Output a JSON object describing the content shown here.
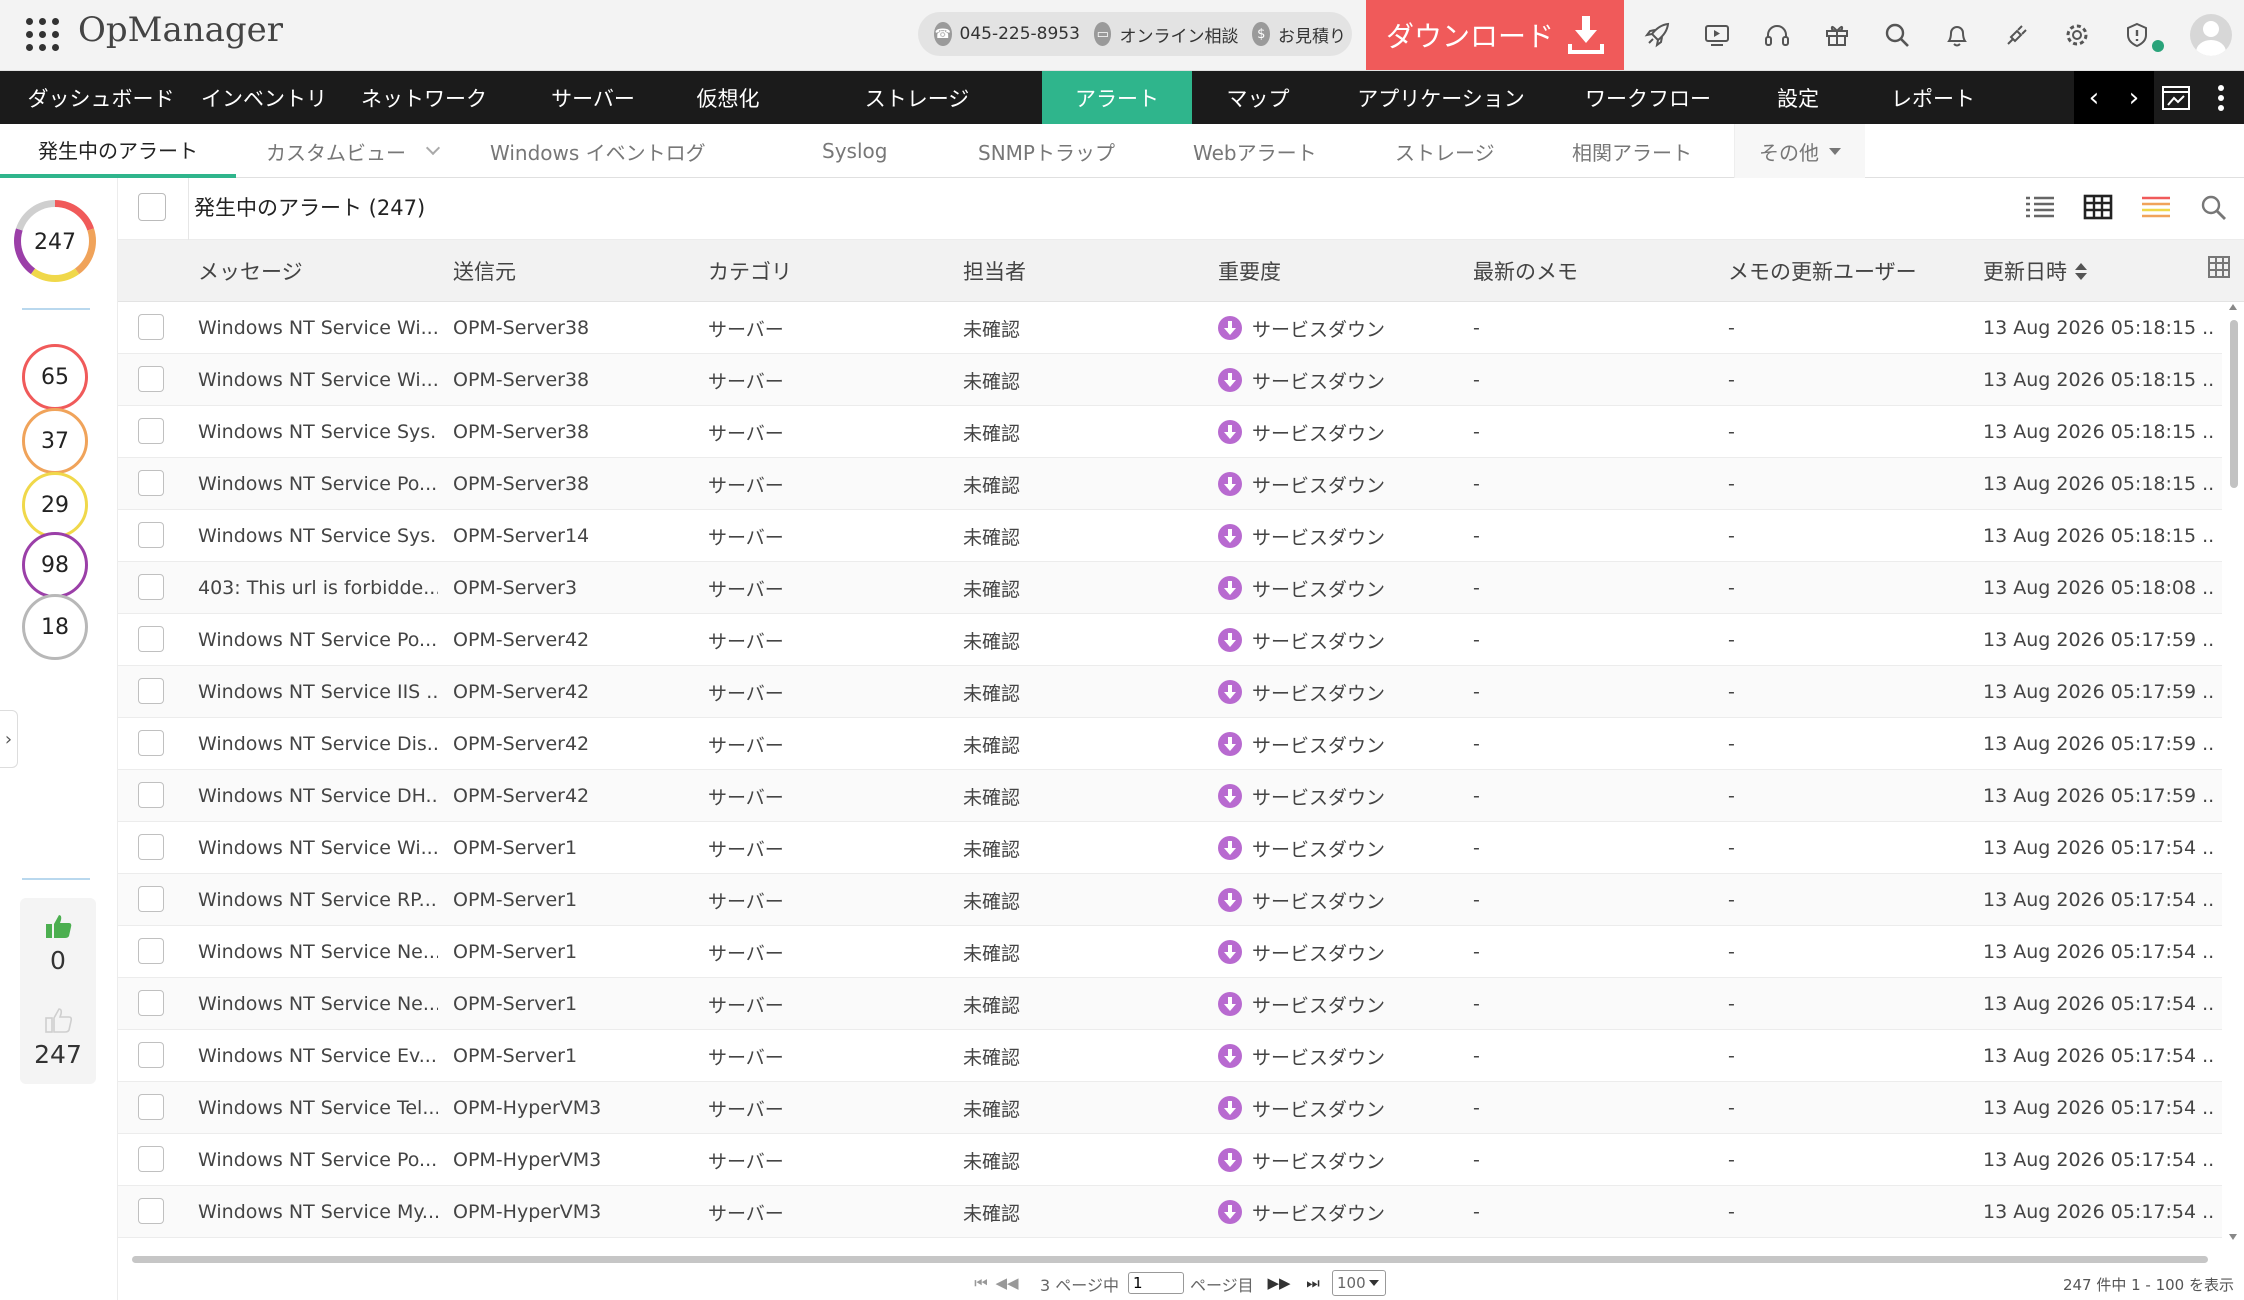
{
  "header": {
    "app_title": "OpManager",
    "phone": "045-225-8953",
    "online_consult": "オンライン相談",
    "quote": "お見積り",
    "download_label": "ダウンロード"
  },
  "nav": {
    "items": [
      {
        "label": "ダッシュボード"
      },
      {
        "label": "インベントリ"
      },
      {
        "label": "ネットワーク"
      },
      {
        "label": "サーバー"
      },
      {
        "label": "仮想化"
      },
      {
        "label": "ストレージ"
      },
      {
        "label": "アラート",
        "active": true
      },
      {
        "label": "マップ"
      },
      {
        "label": "アプリケーション"
      },
      {
        "label": "ワークフロー"
      },
      {
        "label": "設定"
      },
      {
        "label": "レポート"
      }
    ]
  },
  "subtabs": [
    {
      "label": "発生中のアラート",
      "active": true
    },
    {
      "label": "カスタムビュー"
    },
    {
      "label": "Windows イベントログ"
    },
    {
      "label": "Syslog"
    },
    {
      "label": "SNMPトラップ"
    },
    {
      "label": "Webアラート"
    },
    {
      "label": "ストレージ"
    },
    {
      "label": "相関アラート"
    },
    {
      "label": "その他"
    }
  ],
  "left_panel": {
    "total": "247",
    "severity_counts": [
      {
        "value": "65",
        "color": "#f05a5a"
      },
      {
        "value": "37",
        "color": "#f0a35a"
      },
      {
        "value": "29",
        "color": "#f0d84a"
      },
      {
        "value": "98",
        "color": "#9b3fa8"
      },
      {
        "value": "18",
        "color": "#b8b8b8"
      }
    ],
    "acknowledged": "0",
    "unacknowledged": "247",
    "donut_colors": [
      "#f05a5a",
      "#f0a35a",
      "#f0d84a",
      "#9b3fa8",
      "#cfcfcf"
    ]
  },
  "list": {
    "title": "発生中のアラート (247)"
  },
  "columns": {
    "message": "メッセージ",
    "source": "送信元",
    "category": "カテゴリ",
    "assignee": "担当者",
    "severity": "重要度",
    "last_note": "最新のメモ",
    "note_user": "メモの更新ユーザー",
    "modified": "更新日時"
  },
  "rows": [
    {
      "message": "Windows NT Service Wi...",
      "source": "OPM-Server38",
      "category": "サーバー",
      "assignee": "未確認",
      "severity": "サービスダウン",
      "note": "-",
      "note_user": "-",
      "modified": "13 Aug 2026 05:18:15 ..."
    },
    {
      "message": "Windows NT Service Wi...",
      "source": "OPM-Server38",
      "category": "サーバー",
      "assignee": "未確認",
      "severity": "サービスダウン",
      "note": "-",
      "note_user": "-",
      "modified": "13 Aug 2026 05:18:15 ..."
    },
    {
      "message": "Windows NT Service Sys...",
      "source": "OPM-Server38",
      "category": "サーバー",
      "assignee": "未確認",
      "severity": "サービスダウン",
      "note": "-",
      "note_user": "-",
      "modified": "13 Aug 2026 05:18:15 ..."
    },
    {
      "message": "Windows NT Service Po...",
      "source": "OPM-Server38",
      "category": "サーバー",
      "assignee": "未確認",
      "severity": "サービスダウン",
      "note": "-",
      "note_user": "-",
      "modified": "13 Aug 2026 05:18:15 ..."
    },
    {
      "message": "Windows NT Service Sys...",
      "source": "OPM-Server14",
      "category": "サーバー",
      "assignee": "未確認",
      "severity": "サービスダウン",
      "note": "-",
      "note_user": "-",
      "modified": "13 Aug 2026 05:18:15 ..."
    },
    {
      "message": "403: This url is forbidde...",
      "source": "OPM-Server3",
      "category": "サーバー",
      "assignee": "未確認",
      "severity": "サービスダウン",
      "note": "-",
      "note_user": "-",
      "modified": "13 Aug 2026 05:18:08 ..."
    },
    {
      "message": "Windows NT Service Po...",
      "source": "OPM-Server42",
      "category": "サーバー",
      "assignee": "未確認",
      "severity": "サービスダウン",
      "note": "-",
      "note_user": "-",
      "modified": "13 Aug 2026 05:17:59 ..."
    },
    {
      "message": "Windows NT Service IIS ...",
      "source": "OPM-Server42",
      "category": "サーバー",
      "assignee": "未確認",
      "severity": "サービスダウン",
      "note": "-",
      "note_user": "-",
      "modified": "13 Aug 2026 05:17:59 ..."
    },
    {
      "message": "Windows NT Service Dis...",
      "source": "OPM-Server42",
      "category": "サーバー",
      "assignee": "未確認",
      "severity": "サービスダウン",
      "note": "-",
      "note_user": "-",
      "modified": "13 Aug 2026 05:17:59 ..."
    },
    {
      "message": "Windows NT Service DH...",
      "source": "OPM-Server42",
      "category": "サーバー",
      "assignee": "未確認",
      "severity": "サービスダウン",
      "note": "-",
      "note_user": "-",
      "modified": "13 Aug 2026 05:17:59 ..."
    },
    {
      "message": "Windows NT Service Wi...",
      "source": "OPM-Server1",
      "category": "サーバー",
      "assignee": "未確認",
      "severity": "サービスダウン",
      "note": "-",
      "note_user": "-",
      "modified": "13 Aug 2026 05:17:54 ..."
    },
    {
      "message": "Windows NT Service RP...",
      "source": "OPM-Server1",
      "category": "サーバー",
      "assignee": "未確認",
      "severity": "サービスダウン",
      "note": "-",
      "note_user": "-",
      "modified": "13 Aug 2026 05:17:54 ..."
    },
    {
      "message": "Windows NT Service Ne...",
      "source": "OPM-Server1",
      "category": "サーバー",
      "assignee": "未確認",
      "severity": "サービスダウン",
      "note": "-",
      "note_user": "-",
      "modified": "13 Aug 2026 05:17:54 ..."
    },
    {
      "message": "Windows NT Service Ne...",
      "source": "OPM-Server1",
      "category": "サーバー",
      "assignee": "未確認",
      "severity": "サービスダウン",
      "note": "-",
      "note_user": "-",
      "modified": "13 Aug 2026 05:17:54 ..."
    },
    {
      "message": "Windows NT Service Ev...",
      "source": "OPM-Server1",
      "category": "サーバー",
      "assignee": "未確認",
      "severity": "サービスダウン",
      "note": "-",
      "note_user": "-",
      "modified": "13 Aug 2026 05:17:54 ..."
    },
    {
      "message": "Windows NT Service Tel...",
      "source": "OPM-HyperVM3",
      "category": "サーバー",
      "assignee": "未確認",
      "severity": "サービスダウン",
      "note": "-",
      "note_user": "-",
      "modified": "13 Aug 2026 05:17:54 ..."
    },
    {
      "message": "Windows NT Service Po...",
      "source": "OPM-HyperVM3",
      "category": "サーバー",
      "assignee": "未確認",
      "severity": "サービスダウン",
      "note": "-",
      "note_user": "-",
      "modified": "13 Aug 2026 05:17:54 ..."
    },
    {
      "message": "Windows NT Service My...",
      "source": "OPM-HyperVM3",
      "category": "サーバー",
      "assignee": "未確認",
      "severity": "サービスダウン",
      "note": "-",
      "note_user": "-",
      "modified": "13 Aug 2026 05:17:54 ..."
    }
  ],
  "pagination": {
    "total_pages_text": "3 ページ中",
    "page_value": "1",
    "page_suffix": "ページ目",
    "per_page": "100",
    "summary": "247 件中 1 - 100 を表示"
  },
  "colors": {
    "accent": "#2fb58c",
    "download": "#f05a5a",
    "severity_icon": "#b86ad0",
    "nav_bg": "#1b1b1b"
  }
}
